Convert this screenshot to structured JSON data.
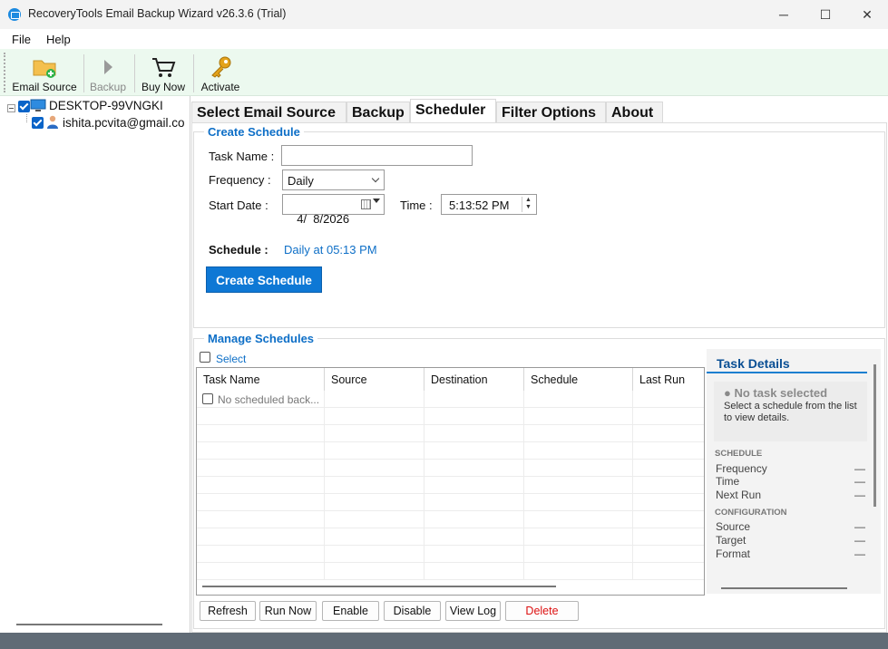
{
  "window": {
    "title": "RecoveryTools Email Backup Wizard v26.3.6 (Trial)",
    "controls": {
      "minimize": "─",
      "maximize": "☐",
      "close": "✕"
    }
  },
  "menu": {
    "items": [
      "File",
      "Help"
    ]
  },
  "toolbar": {
    "email_source": "Email Source",
    "backup": "Backup",
    "buy_now": "Buy Now",
    "activate": "Activate"
  },
  "tree": {
    "computer": "DESKTOP-99VNGKI",
    "account": "ishita.pcvita@gmail.co"
  },
  "tabs": [
    "Select Email Source",
    "Backup",
    "Scheduler",
    "Filter Options",
    "About"
  ],
  "create_schedule": {
    "group_title": "Create Schedule",
    "task_name_label": "Task Name :",
    "task_name_value": "",
    "frequency_label": "Frequency :",
    "frequency_value": "Daily",
    "start_date_label": "Start Date :",
    "start_date_value": "4/  8/2026",
    "time_label": "Time :",
    "time_value": "5:13:52 PM",
    "schedule_label": "Schedule :",
    "schedule_value": "Daily at 05:13 PM",
    "button": "Create Schedule"
  },
  "manage_schedules": {
    "group_title": "Manage Schedules",
    "select_label": "Select",
    "columns": [
      "Task Name",
      "Source",
      "Destination",
      "Schedule",
      "Last Run"
    ],
    "empty_text": "No scheduled back...",
    "buttons": {
      "refresh": "Refresh",
      "run_now": "Run Now",
      "enable": "Enable",
      "disable": "Disable",
      "view_log": "View Log",
      "delete": "Delete"
    }
  },
  "task_details": {
    "title": "Task Details",
    "empty_heading": "● No task selected",
    "empty_text": "Select a schedule from the list to view details.",
    "schedule_section": "SCHEDULE",
    "frequency": "Frequency",
    "time": "Time",
    "next_run": "Next Run",
    "configuration_section": "CONFIGURATION",
    "source": "Source",
    "target": "Target",
    "format": "Format",
    "empty_value": "—"
  },
  "colors": {
    "accent": "#0e78d5",
    "toolbar_bg": "#ecf9ef",
    "status_bar": "#606b76",
    "danger": "#dd1111"
  }
}
